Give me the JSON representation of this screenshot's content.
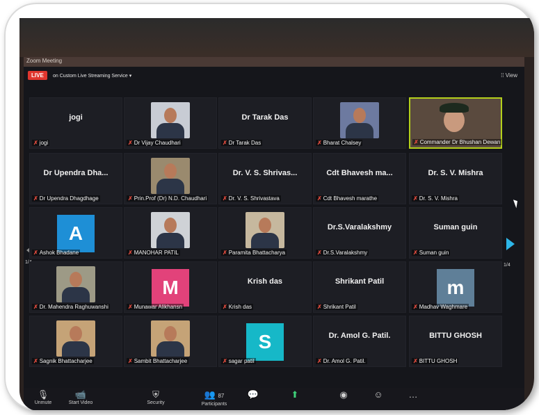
{
  "app": {
    "title": "Zoom Meeting"
  },
  "topbar": {
    "live_label": "LIVE",
    "stream_label": "on Custom Live Streaming Service",
    "view_label": "View"
  },
  "pagination": {
    "label_left": "1/4",
    "label_right": "1/4"
  },
  "participants": [
    {
      "display": "jogi",
      "label": "jogi"
    },
    {
      "display": "",
      "label": "Dr Vijay Chaudhari"
    },
    {
      "display": "Dr Tarak Das",
      "label": "Dr Tarak Das"
    },
    {
      "display": "",
      "label": "Bharat Chalsey"
    },
    {
      "display": "",
      "label": "Commander Dr Bhushan Dewan"
    },
    {
      "display": "Dr Upendra Dha...",
      "label": "Dr Upendra Dhagdhage"
    },
    {
      "display": "",
      "label": "Prin.Prof (Dr) N.D. Chaudhari"
    },
    {
      "display": "Dr. V. S. Shrivas...",
      "label": "Dr. V. S. Shrivastava"
    },
    {
      "display": "Cdt Bhavesh ma...",
      "label": "Cdt Bhavesh marathe"
    },
    {
      "display": "Dr. S. V. Mishra",
      "label": "Dr. S. V. Mishra"
    },
    {
      "display": "A",
      "label": "Ashok Bhadane"
    },
    {
      "display": "",
      "label": "MANOHAR PATIL"
    },
    {
      "display": "",
      "label": "Paramita Bhattacharya"
    },
    {
      "display": "Dr.S.Varalakshmy",
      "label": "Dr.S.Varalakshmy"
    },
    {
      "display": "Suman guin",
      "label": "Suman guin"
    },
    {
      "display": "",
      "label": "Dr. Mahendra Raghuwanshi"
    },
    {
      "display": "M",
      "label": "Munawar Alikhansn"
    },
    {
      "display": "Krish das",
      "label": "Krish das"
    },
    {
      "display": "Shrikant Patil",
      "label": "Shrikant Patil"
    },
    {
      "display": "m",
      "label": "Madhav Waghmare"
    },
    {
      "display": "",
      "label": "Sagnik Bhattacharjee"
    },
    {
      "display": "",
      "label": "Sambit Bhattacharjee"
    },
    {
      "display": "S",
      "label": "sagar patil"
    },
    {
      "display": "Dr. Amol G. Patil.",
      "label": "Dr. Amol G. Patil."
    },
    {
      "display": "BITTU GHOSH",
      "label": "BITTU GHOSH"
    }
  ],
  "avatars": {
    "A": "#1e8fd6",
    "M": "#e2427a",
    "m": "#5f7f98",
    "S": "#16b8c8"
  },
  "toolbar": {
    "unmute_label": "Unmute",
    "start_video_label": "Start Video",
    "security_label": "Security",
    "participants_count": "87",
    "participants_label": "Participants"
  }
}
